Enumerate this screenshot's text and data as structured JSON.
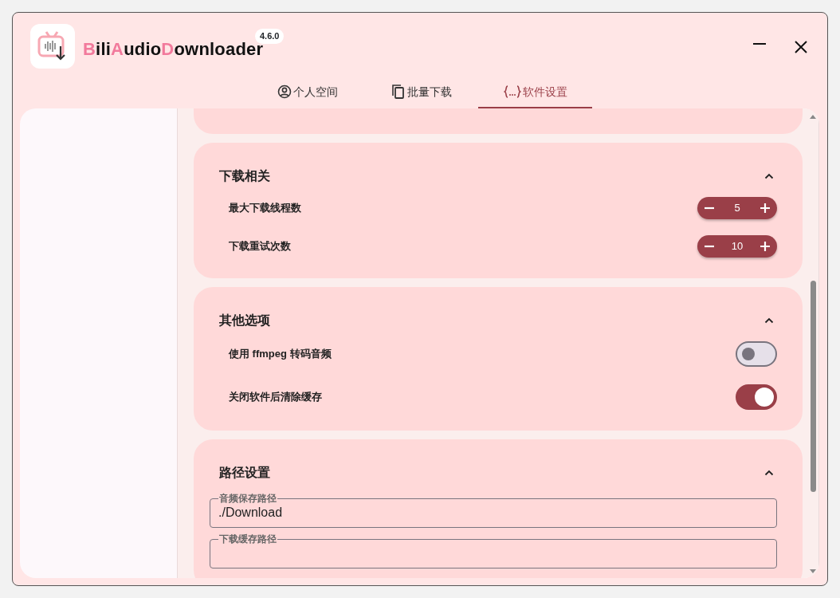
{
  "app": {
    "title_parts": [
      {
        "text": "B",
        "accent": true
      },
      {
        "text": "ili",
        "accent": false
      },
      {
        "text": "A",
        "accent": true
      },
      {
        "text": "udio",
        "accent": false
      },
      {
        "text": "D",
        "accent": true
      },
      {
        "text": "ownloader",
        "accent": false
      }
    ],
    "version": "4.6.0"
  },
  "tabs": [
    {
      "kind": "user",
      "label": "个人空间",
      "selected": false
    },
    {
      "kind": "copy",
      "label": "批量下载",
      "selected": false
    },
    {
      "kind": "code",
      "label": "软件设置",
      "selected": true
    }
  ],
  "sections": [
    {
      "title": "下载相关",
      "expanded": true,
      "rows": [
        {
          "kind": "stepper",
          "label": "最大下载线程数",
          "value": "5"
        },
        {
          "kind": "stepper",
          "label": "下载重试次数",
          "value": "10"
        }
      ]
    },
    {
      "title": "其他选项",
      "expanded": true,
      "rows": [
        {
          "kind": "toggle",
          "label": "使用 ffmpeg 转码音频",
          "on": false
        },
        {
          "kind": "toggle",
          "label": "关闭软件后清除缓存",
          "on": true
        }
      ]
    },
    {
      "title": "路径设置",
      "expanded": true,
      "rows": [
        {
          "kind": "field",
          "label": "音频保存路径",
          "value": "./Download"
        },
        {
          "kind": "field",
          "label": "下载缓存路径"
        }
      ]
    }
  ]
}
